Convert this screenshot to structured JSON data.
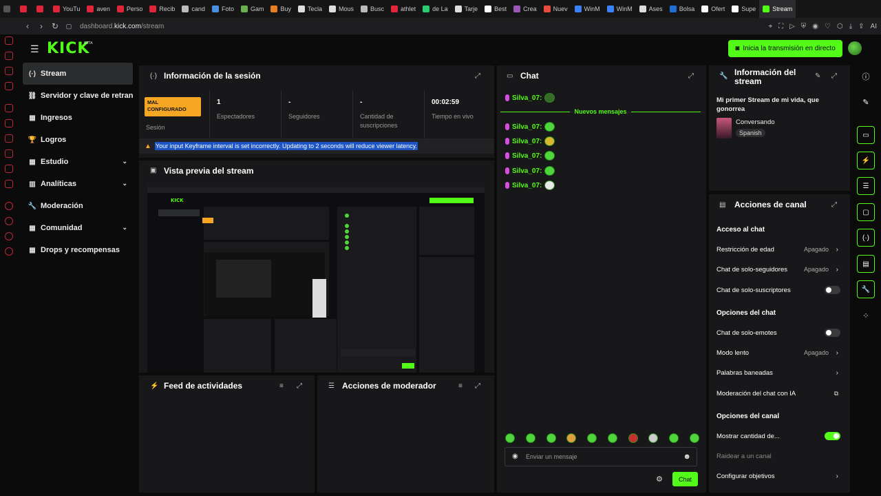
{
  "browser": {
    "tabs": [
      "",
      "",
      "",
      "YouTu",
      "aven",
      "Perso",
      "Recib",
      "cand",
      "Foto",
      "Gam",
      "Buy",
      "Tecla",
      "Mous",
      "Busc",
      "athlet",
      "de La",
      "Tarje",
      "Best",
      "Crea",
      "Nuev",
      "WinM",
      "WinM",
      "Ases",
      "Bolsa",
      "Ofert",
      "Supe",
      "Stream"
    ],
    "tab_colors": [
      "#555",
      "#e0243a",
      "#e0243a",
      "#e0243a",
      "#e0243a",
      "#e0243a",
      "#e0243a",
      "#bbb",
      "#4a90e2",
      "#6ab04c",
      "#e67e22",
      "#ddd",
      "#ddd",
      "#bbb",
      "#e0243a",
      "#2ecc71",
      "#ddd",
      "#fff",
      "#9b59b6",
      "#e74c3c",
      "#3b82f6",
      "#3b82f6",
      "#ddd",
      "#1e6fd8",
      "#fff",
      "#fff",
      "#53fc18"
    ],
    "url_prefix": "dashboard.",
    "url_domain": "kick.com",
    "url_path": "/stream",
    "ai_label": "AI"
  },
  "header": {
    "logo": "KICK",
    "beta": "BETA",
    "golive_label": "Inicia la transmisión en directo"
  },
  "sidebar": {
    "items": [
      {
        "label": "Stream",
        "icon": "(·)"
      },
      {
        "label": "Servidor y clave de retransmisión",
        "icon": "⛓"
      },
      {
        "label": "Ingresos",
        "icon": "▦"
      },
      {
        "label": "Logros",
        "icon": "🏆"
      },
      {
        "label": "Estudio",
        "icon": "▦"
      },
      {
        "label": "Analíticas",
        "icon": "▥"
      },
      {
        "label": "Moderación",
        "icon": "🔧"
      },
      {
        "label": "Comunidad",
        "icon": "▦"
      },
      {
        "label": "Drops y recompensas",
        "icon": "▦"
      }
    ]
  },
  "session": {
    "title": "Información de la sesión",
    "status": "MAL CONFIGURADO",
    "status_label": "Sesión",
    "viewers_value": "1",
    "viewers_label": "Espectadores",
    "followers_value": "-",
    "followers_label": "Seguidores",
    "subs_value": "-",
    "subs_label": "Cantidad de suscripciones",
    "time_value": "00:02:59",
    "time_label": "Tiempo en vivo",
    "warning": "Your input Keyframe interval is set incorrectly. Updating to 2 seconds will reduce viewer latency."
  },
  "preview": {
    "title": "Vista previa del stream"
  },
  "activity": {
    "title": "Feed de actividades"
  },
  "modactions": {
    "title": "Acciones de moderador"
  },
  "chat": {
    "title": "Chat",
    "new_messages": "Nuevos mensajes",
    "username": "Silva_07:",
    "input_placeholder": "Enviar un mensaje",
    "send_label": "Chat"
  },
  "stream_info": {
    "title": "Información del stream",
    "stream_title": "Mi primer Stream de mi vida, que gonorrea",
    "category": "Conversando",
    "language": "Spanish"
  },
  "channel_actions": {
    "title": "Acciones de canal",
    "chat_access": "Acceso al chat",
    "age_restriction": "Restricción de edad",
    "age_value": "Apagado",
    "followers_only": "Chat de solo-seguidores",
    "followers_value": "Apagado",
    "subs_only": "Chat de solo-suscriptores",
    "chat_options": "Opciones del chat",
    "emotes_only": "Chat de solo-emotes",
    "slow_mode": "Modo lento",
    "slow_value": "Apagado",
    "banned_words": "Palabras baneadas",
    "ai_moderation": "Moderación del chat con IA",
    "channel_options": "Opciones del canal",
    "show_count": "Mostrar cantidad de...",
    "raid": "Raidear a un canal",
    "goals": "Configurar objetivos"
  }
}
